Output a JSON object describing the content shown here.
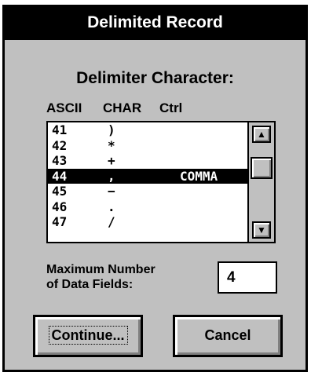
{
  "dialog": {
    "title": "Delimited Record",
    "heading": "Delimiter Character:"
  },
  "columns": {
    "ascii": "ASCII",
    "char": "CHAR",
    "ctrl": "Ctrl"
  },
  "list": {
    "items": [
      {
        "ascii": "41",
        "char": ")",
        "ctrl": ""
      },
      {
        "ascii": "42",
        "char": "*",
        "ctrl": ""
      },
      {
        "ascii": "43",
        "char": "+",
        "ctrl": ""
      },
      {
        "ascii": "44",
        "char": ",",
        "ctrl": "COMMA"
      },
      {
        "ascii": "45",
        "char": "−",
        "ctrl": ""
      },
      {
        "ascii": "46",
        "char": ".",
        "ctrl": ""
      },
      {
        "ascii": "47",
        "char": "/",
        "ctrl": ""
      }
    ],
    "selected_index": 3
  },
  "fields": {
    "label_line1": "Maximum Number",
    "label_line2": "of Data Fields:",
    "value": "4"
  },
  "buttons": {
    "continue_label": "Continue...",
    "cancel_label": "Cancel"
  },
  "icons": {
    "scroll_up": "up-arrow-icon",
    "scroll_down": "down-arrow-icon"
  }
}
